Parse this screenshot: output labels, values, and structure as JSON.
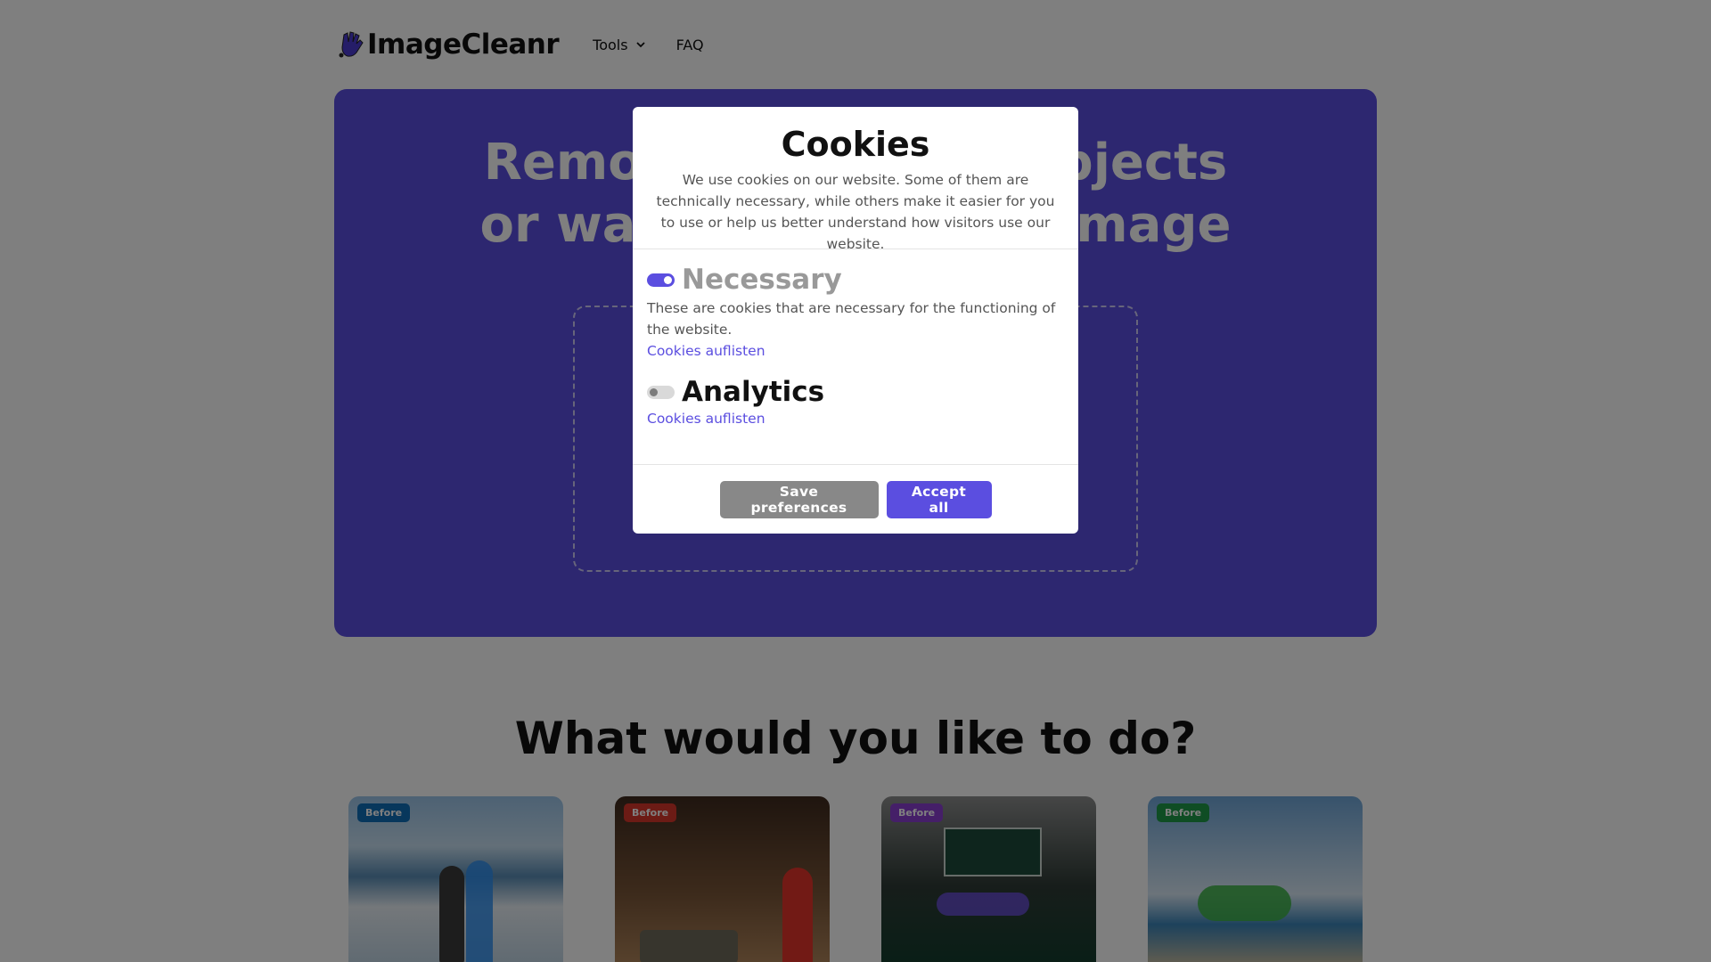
{
  "header": {
    "brand": "ImageCleanr",
    "nav": [
      {
        "label": "Tools",
        "has_dropdown": true
      },
      {
        "label": "FAQ",
        "has_dropdown": false
      }
    ]
  },
  "hero": {
    "title_line1": "Remove unwanted objects",
    "title_line2": "or watermarks from image"
  },
  "section": {
    "title": "What would you like to do?",
    "cards": [
      {
        "badge": "Before",
        "badge_color": "#0f6fb8"
      },
      {
        "badge": "Before",
        "badge_color": "#d8362b"
      },
      {
        "badge": "Before",
        "badge_color": "#8a3fd1"
      },
      {
        "badge": "Before",
        "badge_color": "#1f9a49"
      }
    ]
  },
  "cookie_modal": {
    "title": "Cookies",
    "description": "We use cookies on our website. Some of them are technically necessary, while others make it easier for you to use or help us better understand how visitors use our website.",
    "categories": [
      {
        "title": "Necessary",
        "enabled": true,
        "locked": true,
        "description": "These are cookies that are necessary for the functioning of the website.",
        "link": "Cookies auflisten"
      },
      {
        "title": "Analytics",
        "enabled": false,
        "locked": false,
        "link": "Cookies auflisten"
      }
    ],
    "buttons": {
      "save": "Save preferences",
      "accept": "Accept all"
    }
  },
  "colors": {
    "brand": "#5b4ee0",
    "overlay": "rgba(0,0,0,0.5)",
    "secondary_button": "#888888"
  }
}
